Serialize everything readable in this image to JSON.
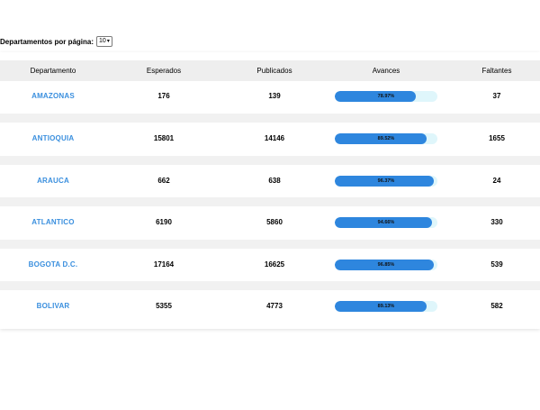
{
  "pagination": {
    "label": "Departamentos por página:",
    "page_size": "10"
  },
  "table": {
    "headers": {
      "departamento": "Departamento",
      "esperados": "Esperados",
      "publicados": "Publicados",
      "avances": "Avances",
      "faltantes": "Faltantes"
    },
    "rows": [
      {
        "departamento": "AMAZONAS",
        "esperados": "176",
        "publicados": "139",
        "avance_label": "78.97%",
        "avance": 78.97,
        "faltantes": "37"
      },
      {
        "departamento": "ANTIOQUIA",
        "esperados": "15801",
        "publicados": "14146",
        "avance_label": "89.52%",
        "avance": 89.52,
        "faltantes": "1655"
      },
      {
        "departamento": "ARAUCA",
        "esperados": "662",
        "publicados": "638",
        "avance_label": "96.37%",
        "avance": 96.37,
        "faltantes": "24"
      },
      {
        "departamento": "ATLANTICO",
        "esperados": "6190",
        "publicados": "5860",
        "avance_label": "94.66%",
        "avance": 94.66,
        "faltantes": "330"
      },
      {
        "departamento": "BOGOTA D.C.",
        "esperados": "17164",
        "publicados": "16625",
        "avance_label": "96.85%",
        "avance": 96.85,
        "faltantes": "539"
      },
      {
        "departamento": "BOLIVAR",
        "esperados": "5355",
        "publicados": "4773",
        "avance_label": "89.13%",
        "avance": 89.13,
        "faltantes": "582"
      }
    ]
  },
  "colors": {
    "link": "#3a8fde",
    "progress_fill": "#2e86de",
    "progress_track": "#dff6fb"
  }
}
